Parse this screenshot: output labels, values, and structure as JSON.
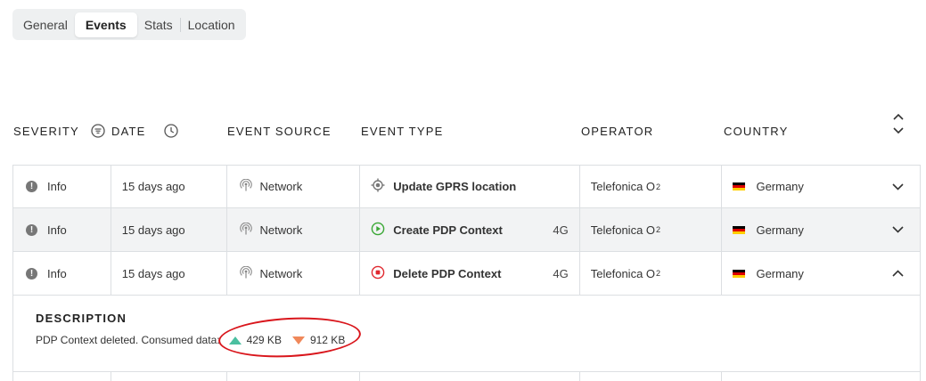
{
  "tabs": [
    {
      "label": "General",
      "active": false
    },
    {
      "label": "Events",
      "active": true
    },
    {
      "label": "Stats",
      "active": false
    },
    {
      "label": "Location",
      "active": false
    }
  ],
  "columns": {
    "severity": "SEVERITY",
    "date": "DATE",
    "event_source": "EVENT SOURCE",
    "event_type": "EVENT TYPE",
    "operator": "OPERATOR",
    "country": "COUNTRY"
  },
  "rows": [
    {
      "severity": "Info",
      "date": "15 days ago",
      "source": "Network",
      "event_type": "Update GPRS location",
      "tech": "",
      "operator": "Telefonica O",
      "operator_sup": "2",
      "country": "Germany",
      "expanded": false,
      "event_icon": "target-icon"
    },
    {
      "severity": "Info",
      "date": "15 days ago",
      "source": "Network",
      "event_type": "Create PDP Context",
      "tech": "4G",
      "operator": "Telefonica O",
      "operator_sup": "2",
      "country": "Germany",
      "expanded": false,
      "event_icon": "play-circle-icon"
    },
    {
      "severity": "Info",
      "date": "15 days ago",
      "source": "Network",
      "event_type": "Delete PDP Context",
      "tech": "4G",
      "operator": "Telefonica O",
      "operator_sup": "2",
      "country": "Germany",
      "expanded": true,
      "event_icon": "stop-circle-icon"
    }
  ],
  "description": {
    "title": "DESCRIPTION",
    "text": "PDP Context deleted. Consumed data:",
    "upload": "429 KB",
    "download": "912 KB"
  },
  "colors": {
    "upload": "#4bbfa0",
    "download": "#f0885a",
    "annotation": "#d9161c",
    "create_icon": "#3aa835",
    "delete_icon": "#e0282e"
  }
}
